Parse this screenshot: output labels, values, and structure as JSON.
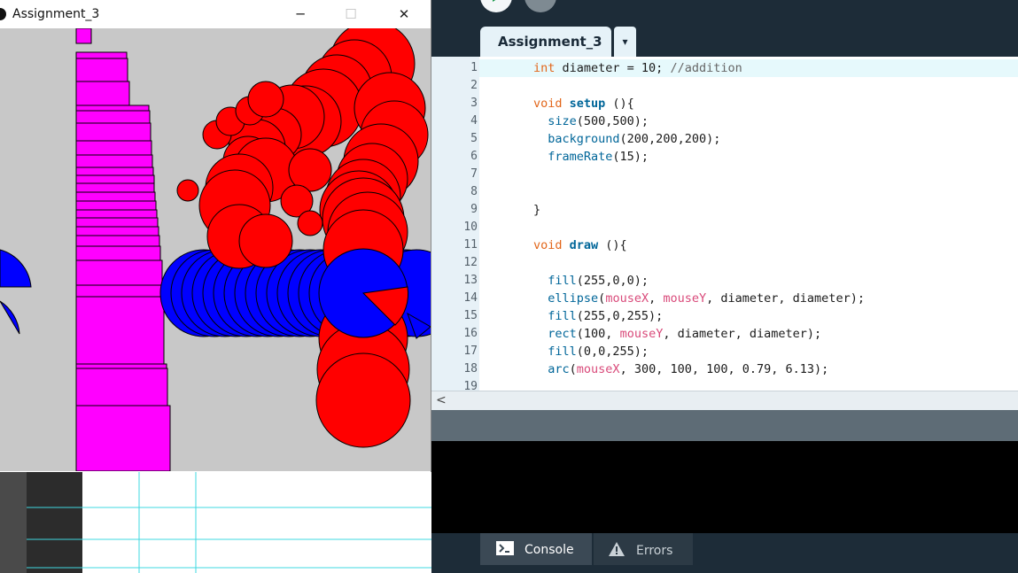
{
  "sketch_window": {
    "title": "Assignment_3",
    "controls": {
      "minimize": "─",
      "maximize": "☐",
      "close": "✕"
    }
  },
  "editor": {
    "tab_title": "Assignment_3",
    "tab_menu": "▾",
    "line_numbers": [
      "1",
      "2",
      "3",
      "4",
      "5",
      "6",
      "7",
      "8",
      "9",
      "10",
      "11",
      "12",
      "13",
      "14",
      "15",
      "16",
      "17",
      "18",
      "19"
    ],
    "scroll_arrow": "<"
  },
  "bottom_tabs": {
    "console": "Console",
    "errors": "Errors"
  },
  "colors": {
    "ide_background": "#1d2c38",
    "highlight_line": "#e6f9fc",
    "keyword": "#e2661a",
    "function": "#006699",
    "variable": "#d94a7a",
    "sketch_background": "#c8c8c8",
    "sketch_red": "#ff0000",
    "sketch_magenta": "#ff00ff",
    "sketch_blue": "#0000ff"
  }
}
